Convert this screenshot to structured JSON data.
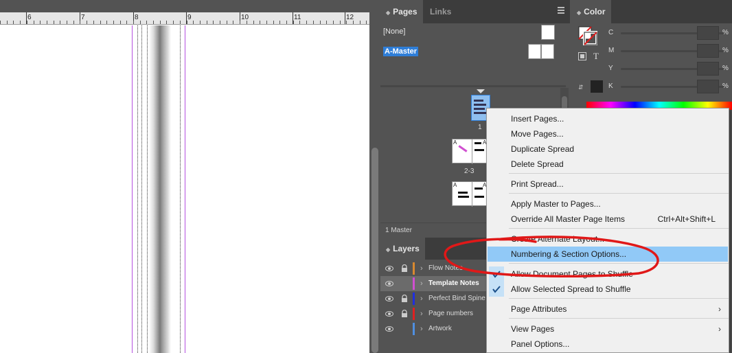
{
  "ruler": {
    "labels": [
      "6",
      "7",
      "8",
      "9",
      "10",
      "11",
      "12"
    ]
  },
  "pages_panel": {
    "tabs": [
      "Pages",
      "Links"
    ],
    "masters": {
      "none": "[None]",
      "a_master": "A-Master"
    },
    "page_labels": [
      "1",
      "2-3"
    ],
    "master_prefix": "A",
    "footer": "1 Master"
  },
  "color_panel": {
    "tab": "Color",
    "channels": [
      "C",
      "M",
      "Y",
      "K"
    ],
    "pct": "%",
    "type_glyph": "T"
  },
  "layers_panel": {
    "tab": "Layers",
    "layers": [
      {
        "name": "Flow Notes",
        "color": "#d9892f",
        "locked": true,
        "selected": false
      },
      {
        "name": "Template Notes",
        "color": "#d04fd0",
        "locked": false,
        "selected": true
      },
      {
        "name": "Perfect Bind Spine",
        "color": "#1f2fe0",
        "locked": true,
        "selected": false
      },
      {
        "name": "Page numbers",
        "color": "#e02020",
        "locked": true,
        "selected": false
      },
      {
        "name": "Artwork",
        "color": "#4f8fe0",
        "locked": false,
        "selected": false
      }
    ]
  },
  "context_menu": {
    "items": [
      {
        "label": "Insert Pages..."
      },
      {
        "label": "Move Pages..."
      },
      {
        "label": "Duplicate Spread"
      },
      {
        "label": "Delete Spread"
      },
      {
        "label": "Print Spread..."
      },
      {
        "label": "Apply Master to Pages..."
      },
      {
        "label": "Override All Master Page Items",
        "shortcut": "Ctrl+Alt+Shift+L"
      },
      {
        "label": "Create Alternate Layout..."
      },
      {
        "label": "Numbering & Section Options..."
      },
      {
        "label": "Allow Document Pages to Shuffle",
        "checked": true
      },
      {
        "label": "Allow Selected Spread to Shuffle",
        "checked": true
      },
      {
        "label": "Page Attributes"
      },
      {
        "label": "View Pages"
      },
      {
        "label": "Panel Options..."
      }
    ]
  },
  "colors": {
    "menu_highlight": "#91c9f7",
    "annotation": "#e01818",
    "guide": "#b44fe0",
    "selection": "#2f7ed8"
  }
}
